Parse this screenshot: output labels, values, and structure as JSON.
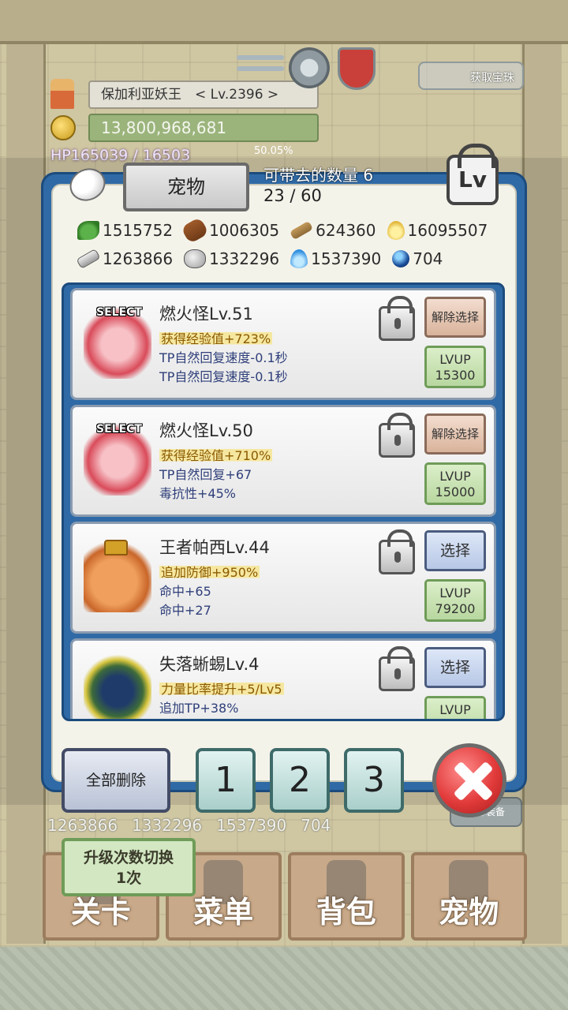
{
  "hud": {
    "player_name": "保加利亚妖王　< Lv.2396 >",
    "gold": "13,800,968,681",
    "hp": "HP165039 / 16503",
    "exp_percent": "50.05%",
    "get_gem_label": "获取宝珠"
  },
  "dialog": {
    "title": "宠物",
    "carry_label": "可带去的数量 6",
    "carry_count": "23 / 60",
    "lv_toggle_label": "Lv"
  },
  "resources": {
    "row1": [
      {
        "icon": "leaf-icon",
        "value": "1515752"
      },
      {
        "icon": "log-icon",
        "value": "1006305"
      },
      {
        "icon": "plank-icon",
        "value": "624360"
      },
      {
        "icon": "gold-drop-icon",
        "value": "16095507"
      }
    ],
    "row2": [
      {
        "icon": "iron-icon",
        "value": "1263866"
      },
      {
        "icon": "stone-icon",
        "value": "1332296"
      },
      {
        "icon": "blue-flame-icon",
        "value": "1537390"
      },
      {
        "icon": "blue-orb-icon",
        "value": "704"
      }
    ]
  },
  "pets": [
    {
      "name": "燃火怪Lv.51",
      "selected_tag": "SELECT",
      "stats": [
        "获得经验值+723%",
        "TP自然回复速度-0.1秒",
        "TP自然回复速度-0.1秒"
      ],
      "action": "解除选择",
      "lvup_label": "LVUP",
      "lvup_cost": "15300"
    },
    {
      "name": "燃火怪Lv.50",
      "selected_tag": "SELECT",
      "stats": [
        "获得经验值+710%",
        "TP自然回复+67",
        "毒抗性+45%"
      ],
      "action": "解除选择",
      "lvup_label": "LVUP",
      "lvup_cost": "15000"
    },
    {
      "name": "王者帕西Lv.44",
      "selected_tag": "",
      "stats": [
        "追加防御+950%",
        "命中+65",
        "命中+27"
      ],
      "action": "选择",
      "lvup_label": "LVUP",
      "lvup_cost": "79200"
    },
    {
      "name": "失落蜥蜴Lv.4",
      "selected_tag": "",
      "stats": [
        "力量比率提升+5/Lv5",
        "追加TP+38%",
        ""
      ],
      "action": "选择",
      "lvup_label": "LVUP",
      "lvup_cost": ""
    }
  ],
  "footer": {
    "clear_all": "全部删除",
    "slots": [
      "1",
      "2",
      "3"
    ]
  },
  "background": {
    "resource_strip": [
      "1263866",
      "1332296",
      "1537390",
      "704"
    ],
    "equip_all": "全部装备",
    "upgrade_toggle_line1": "升级次数切换",
    "upgrade_toggle_line2": "1次",
    "nav": [
      "关卡",
      "菜单",
      "背包",
      "宠物"
    ]
  },
  "colors": {
    "modal_blue": "#2f6aa6",
    "panel_bg": "#f4f3ea",
    "accent_red": "#e23b3b",
    "lvup_green": "#b8d79f"
  }
}
